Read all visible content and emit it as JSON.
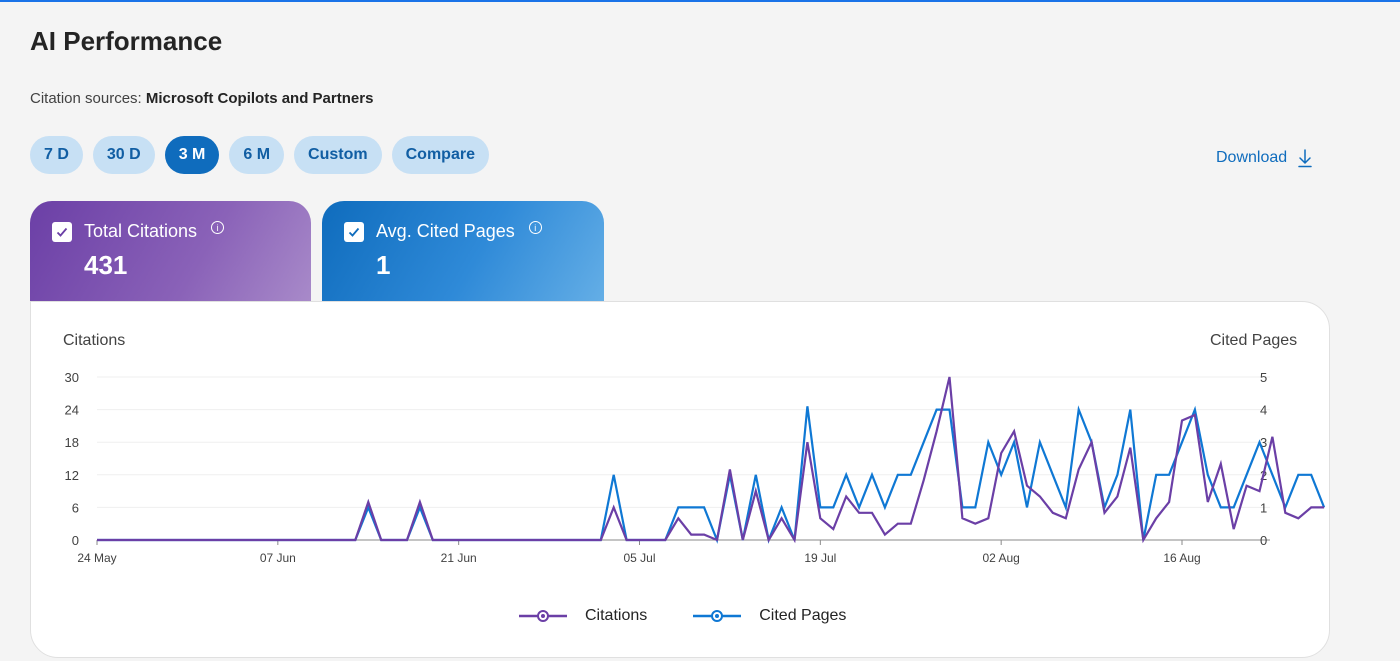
{
  "header": {
    "title": "AI Performance",
    "sources_label": "Citation sources:",
    "sources_value": "Microsoft Copilots and Partners"
  },
  "filters": [
    {
      "label": "7 D",
      "active": false
    },
    {
      "label": "30 D",
      "active": false
    },
    {
      "label": "3 M",
      "active": true
    },
    {
      "label": "6 M",
      "active": false
    },
    {
      "label": "Custom",
      "active": false
    },
    {
      "label": "Compare",
      "active": false
    }
  ],
  "download_label": "Download",
  "cards": {
    "citations": {
      "label": "Total Citations",
      "value": "431"
    },
    "cited_pages": {
      "label": "Avg. Cited Pages",
      "value": "1"
    }
  },
  "colors": {
    "citations": "#6b3fa6",
    "cited_pages": "#0f78d4"
  },
  "chart_data": {
    "type": "line",
    "ylabel": "Citations",
    "y2label": "Cited Pages",
    "ylim": [
      0,
      30
    ],
    "y2lim": [
      0,
      5
    ],
    "yticks": [
      0,
      6,
      12,
      18,
      24,
      30
    ],
    "y2ticks": [
      0,
      1,
      2,
      3,
      4,
      5
    ],
    "x_ticks": [
      "24 May",
      "07 Jun",
      "21 Jun",
      "05 Jul",
      "19 Jul",
      "02 Aug",
      "16 Aug"
    ],
    "x_start": "24 May",
    "legend": [
      "Citations",
      "Cited Pages"
    ],
    "series": [
      {
        "name": "Citations",
        "axis": "left",
        "values": [
          0,
          0,
          0,
          0,
          0,
          0,
          0,
          0,
          0,
          0,
          0,
          0,
          0,
          0,
          0,
          0,
          0,
          0,
          0,
          0,
          0,
          7,
          0,
          0,
          0,
          7,
          0,
          0,
          0,
          0,
          0,
          0,
          0,
          0,
          0,
          0,
          0,
          0,
          0,
          0,
          6,
          0,
          0,
          0,
          0,
          4,
          1,
          1,
          0,
          13,
          0,
          9,
          0,
          4,
          0,
          18,
          4,
          2,
          8,
          5,
          5,
          1,
          3,
          3,
          11,
          20,
          30,
          4,
          3,
          4,
          16,
          20,
          10,
          8,
          5,
          4,
          13,
          18,
          5,
          8,
          17,
          0,
          4,
          7,
          22,
          23,
          7,
          14,
          2,
          10,
          9,
          19,
          5,
          4,
          6,
          6
        ]
      },
      {
        "name": "Cited Pages",
        "axis": "right",
        "values": [
          0,
          0,
          0,
          0,
          0,
          0,
          0,
          0,
          0,
          0,
          0,
          0,
          0,
          0,
          0,
          0,
          0,
          0,
          0,
          0,
          0,
          1,
          0,
          0,
          0,
          1,
          0,
          0,
          0,
          0,
          0,
          0,
          0,
          0,
          0,
          0,
          0,
          0,
          0,
          0,
          2,
          0,
          0,
          0,
          0,
          1,
          1,
          1,
          0,
          2,
          0,
          2,
          0,
          1,
          0,
          4.1,
          1,
          1,
          2,
          1,
          2,
          1,
          2,
          2,
          3,
          4,
          4,
          1,
          1,
          3,
          2,
          3,
          1,
          3,
          2,
          1,
          4,
          3,
          1,
          2,
          4,
          0,
          2,
          2,
          3,
          4,
          2,
          1,
          1,
          2,
          3,
          2,
          1,
          2,
          2,
          1
        ]
      }
    ]
  }
}
